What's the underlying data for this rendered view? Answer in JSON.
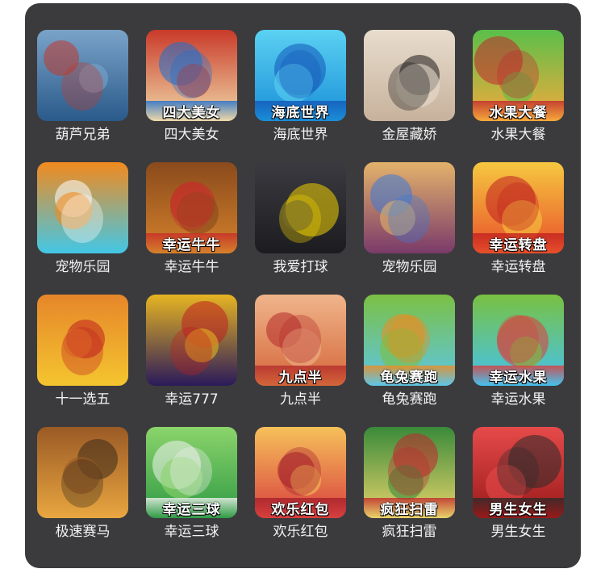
{
  "games": [
    {
      "label": "葫芦兄弟",
      "banner": "",
      "icon": "calabash-brothers-icon",
      "colors": [
        "#2a5a8a",
        "#7aa3c9",
        "#c0392b"
      ]
    },
    {
      "label": "四大美女",
      "banner": "四大美女",
      "icon": "four-beauties-icon",
      "colors": [
        "#f0d9a8",
        "#c93a2a",
        "#1c6fd1"
      ]
    },
    {
      "label": "海底世界",
      "banner": "海底世界",
      "icon": "undersea-world-icon",
      "colors": [
        "#1a8fd8",
        "#5bd1f2",
        "#1456b8"
      ]
    },
    {
      "label": "金屋藏娇",
      "banner": "",
      "icon": "golden-house-icon",
      "colors": [
        "#c7b29c",
        "#e8dccd",
        "#1a1a1a"
      ]
    },
    {
      "label": "水果大餐",
      "banner": "水果大餐",
      "icon": "fruit-feast-icon",
      "colors": [
        "#f6a93b",
        "#5bbf4a",
        "#c1272d"
      ]
    },
    {
      "label": "宠物乐园",
      "banner": "",
      "icon": "orange-cat-icon",
      "colors": [
        "#42c7e6",
        "#f28a1e",
        "#ffffff"
      ]
    },
    {
      "label": "幸运牛牛",
      "banner": "幸运牛牛",
      "icon": "lucky-bull-icon",
      "colors": [
        "#d4822b",
        "#8a4a1c",
        "#c92a2a"
      ]
    },
    {
      "label": "我爱打球",
      "banner": "",
      "icon": "soccer-girl-icon",
      "colors": [
        "#1c1c20",
        "#3a3a40",
        "#f1d200"
      ]
    },
    {
      "label": "宠物乐园",
      "banner": "",
      "icon": "cartoon-rabbit-icon",
      "colors": [
        "#7a3a6a",
        "#e3b26b",
        "#3a7ad8"
      ]
    },
    {
      "label": "幸运转盘",
      "banner": "幸运转盘",
      "icon": "lucky-wheel-icon",
      "colors": [
        "#e8502a",
        "#f6c840",
        "#c01f1f"
      ]
    },
    {
      "label": "十一选五",
      "banner": "",
      "icon": "eleven-pick-five-icon",
      "colors": [
        "#f4c52f",
        "#e6862a",
        "#c01f1f"
      ]
    },
    {
      "label": "幸运777",
      "banner": "",
      "icon": "slot-777-icon",
      "colors": [
        "#2a1a5a",
        "#e6b422",
        "#c01f1f"
      ]
    },
    {
      "label": "九点半",
      "banner": "九点半",
      "icon": "nine-thirty-icon",
      "colors": [
        "#d4673a",
        "#f0b48a",
        "#b22a2a"
      ]
    },
    {
      "label": "龟兔赛跑",
      "banner": "龟兔赛跑",
      "icon": "tortoise-hare-icon",
      "colors": [
        "#5cc6e8",
        "#7bc043",
        "#f28a1e"
      ]
    },
    {
      "label": "幸运水果",
      "banner": "幸运水果",
      "icon": "lucky-fruit-icon",
      "colors": [
        "#43c3f0",
        "#79c142",
        "#e03a3a"
      ]
    },
    {
      "label": "极速赛马",
      "banner": "",
      "icon": "horse-racing-icon",
      "colors": [
        "#e9a640",
        "#9a5a25",
        "#3a2a1a"
      ]
    },
    {
      "label": "幸运三球",
      "banner": "幸运三球",
      "icon": "lucky-three-balls-icon",
      "colors": [
        "#2f9a44",
        "#8bd46b",
        "#f2f2f2"
      ]
    },
    {
      "label": "欢乐红包",
      "banner": "欢乐红包",
      "icon": "red-envelope-icon",
      "colors": [
        "#d8403e",
        "#f6c15a",
        "#a41e2a"
      ]
    },
    {
      "label": "疯狂扫雷",
      "banner": "疯狂扫雷",
      "icon": "minesweeper-icon",
      "colors": [
        "#e8d46a",
        "#3a8a3a",
        "#c1272d"
      ]
    },
    {
      "label": "男生女生",
      "banner": "男生女生",
      "icon": "boys-girls-icon",
      "colors": [
        "#9a1a1a",
        "#e64a4a",
        "#2a2a2a"
      ]
    }
  ],
  "banner_text_color": "#ffffff",
  "panel_color": "#3b3b3d"
}
